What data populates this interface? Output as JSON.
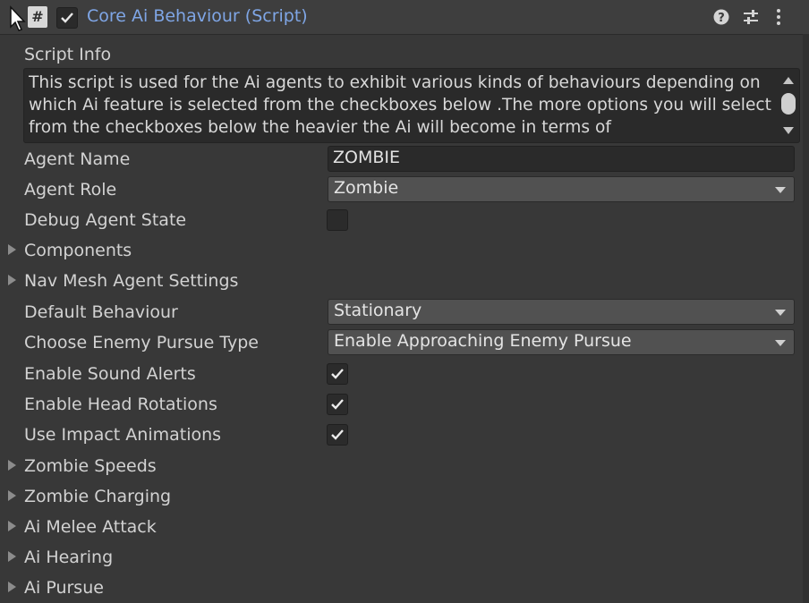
{
  "header": {
    "title": "Core Ai Behaviour (Script)",
    "script_icon_glyph": "#",
    "enabled": true
  },
  "script_info": {
    "label": "Script Info",
    "text": "This script is used for the Ai agents to exhibit various kinds of behaviours depending on which Ai feature is selected from the checkboxes below .The more options you will select from the checkboxes below the heavier the Ai will become in terms of"
  },
  "agent_name": {
    "label": "Agent Name",
    "value": "ZOMBIE"
  },
  "agent_role": {
    "label": "Agent Role",
    "value": "Zombie"
  },
  "debug_agent_state": {
    "label": "Debug Agent State",
    "checked": false
  },
  "components": {
    "label": "Components"
  },
  "nav_mesh": {
    "label": "Nav Mesh Agent Settings"
  },
  "default_behaviour": {
    "label": "Default Behaviour",
    "value": "Stationary"
  },
  "pursue_type": {
    "label": "Choose Enemy Pursue Type",
    "value": "Enable Approaching Enemy Pursue"
  },
  "sound_alerts": {
    "label": "Enable Sound Alerts",
    "checked": true
  },
  "head_rotations": {
    "label": "Enable Head Rotations",
    "checked": true
  },
  "impact_animations": {
    "label": "Use Impact Animations",
    "checked": true
  },
  "foldouts": [
    "Zombie Speeds",
    "Zombie Charging",
    "Ai Melee Attack",
    "Ai Hearing",
    "Ai Pursue"
  ],
  "icons": {
    "help": "help-icon",
    "presets": "presets-icon",
    "menu": "kebab-menu-icon"
  }
}
